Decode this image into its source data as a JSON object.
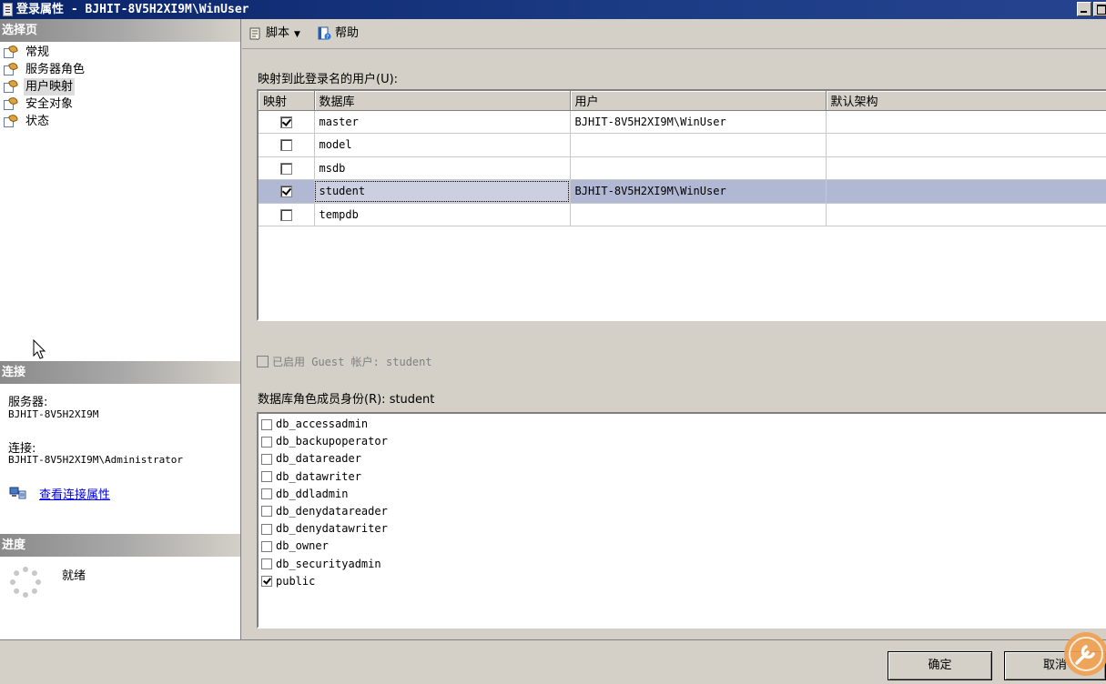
{
  "window": {
    "title": "登录属性 - BJHIT-8V5H2XI9M\\WinUser"
  },
  "left_pane": {
    "select_page_header": "选择页",
    "pages": [
      {
        "label": "常规"
      },
      {
        "label": "服务器角色"
      },
      {
        "label": "用户映射",
        "selected": true
      },
      {
        "label": "安全对象"
      },
      {
        "label": "状态"
      }
    ],
    "connection": {
      "header": "连接",
      "server_label": "服务器:",
      "server_value": "BJHIT-8V5H2XI9M",
      "connection_label": "连接:",
      "connection_value": "BJHIT-8V5H2XI9M\\Administrator",
      "view_properties_link": "查看连接属性"
    },
    "progress": {
      "header": "进度",
      "status": "就绪"
    }
  },
  "toolbar": {
    "script_label": "脚本",
    "help_label": "帮助"
  },
  "user_mapping": {
    "label": "映射到此登录名的用户(U):",
    "columns": [
      "映射",
      "数据库",
      "用户",
      "默认架构"
    ],
    "rows": [
      {
        "mapped": true,
        "database": "master",
        "user": "BJHIT-8V5H2XI9M\\WinUser",
        "schema": ""
      },
      {
        "mapped": false,
        "database": "model",
        "user": "",
        "schema": ""
      },
      {
        "mapped": false,
        "database": "msdb",
        "user": "",
        "schema": ""
      },
      {
        "mapped": true,
        "database": "student",
        "user": "BJHIT-8V5H2XI9M\\WinUser",
        "schema": "",
        "selected": true
      },
      {
        "mapped": false,
        "database": "tempdb",
        "user": "",
        "schema": ""
      }
    ],
    "ellipsis": "..."
  },
  "guest": {
    "label": "已启用 Guest 帐户: student",
    "enabled": false
  },
  "roles": {
    "label": "数据库角色成员身份(R): student",
    "items": [
      {
        "name": "db_accessadmin",
        "checked": false
      },
      {
        "name": "db_backupoperator",
        "checked": false
      },
      {
        "name": "db_datareader",
        "checked": false
      },
      {
        "name": "db_datawriter",
        "checked": false
      },
      {
        "name": "db_ddladmin",
        "checked": false
      },
      {
        "name": "db_denydatareader",
        "checked": false
      },
      {
        "name": "db_denydatawriter",
        "checked": false
      },
      {
        "name": "db_owner",
        "checked": false
      },
      {
        "name": "db_securityadmin",
        "checked": false
      },
      {
        "name": "public",
        "checked": true
      }
    ]
  },
  "buttons": {
    "ok": "确定",
    "cancel": "取消"
  },
  "colors": {
    "title_bar": "#0a246a",
    "selection": "#b0b8d4",
    "link": "#0000ee",
    "badge": "#f0a050"
  },
  "icons": {
    "page": "wrench-page-icon",
    "script": "script-icon",
    "help": "help-icon",
    "connection": "connection-icon",
    "progress": "spinner-icon",
    "tool_badge": "wrench-icon"
  }
}
